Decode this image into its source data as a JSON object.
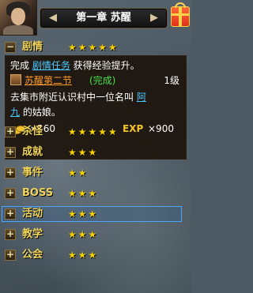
{
  "header": {
    "chapter_title": "第一章 苏醒",
    "arrow_left": "◀",
    "arrow_right": "▶"
  },
  "categories": [
    {
      "toggle": "−",
      "label": "剧情",
      "stars": "★★★★★",
      "expanded": true
    },
    {
      "toggle": "+",
      "label": "杀怪",
      "stars": "★★★★★"
    },
    {
      "toggle": "+",
      "label": "成就",
      "stars": "★★★"
    },
    {
      "toggle": "+",
      "label": "事件",
      "stars": "★★"
    },
    {
      "toggle": "+",
      "label": "BOSS",
      "stars": "★★★"
    },
    {
      "toggle": "+",
      "label": "活动",
      "stars": "★★★",
      "selected": true
    },
    {
      "toggle": "+",
      "label": "教学",
      "stars": "★★★"
    },
    {
      "toggle": "+",
      "label": "公会",
      "stars": "★★★"
    }
  ],
  "detail": {
    "line1_prefix": "完成 ",
    "line1_link": "剧情任务",
    "line1_suffix": " 获得经验提升。",
    "quest_name": "苏醒第二节",
    "quest_status": "(完成)",
    "quest_level": "1级",
    "desc_line1_text": "去集市附近认识村中一位名叫 ",
    "desc_line1_link": "阿",
    "desc_line2_link": "九",
    "desc_line2_text": " 的姑娘。",
    "gold_reward": "×360",
    "exp_label": "EXP",
    "exp_reward": "×900"
  },
  "colors": {
    "category_label": "#f2d55a",
    "stars": "#f6d000",
    "link": "#4dc8ff",
    "quest_name": "#ff9a2a",
    "complete_status": "#4be04b",
    "selected_border": "#4aa6ff"
  },
  "icons": {
    "avatar": "character-portrait",
    "gift": "gift-box-icon",
    "gold": "gold-coin-icon",
    "quest": "quest-scroll-icon"
  }
}
